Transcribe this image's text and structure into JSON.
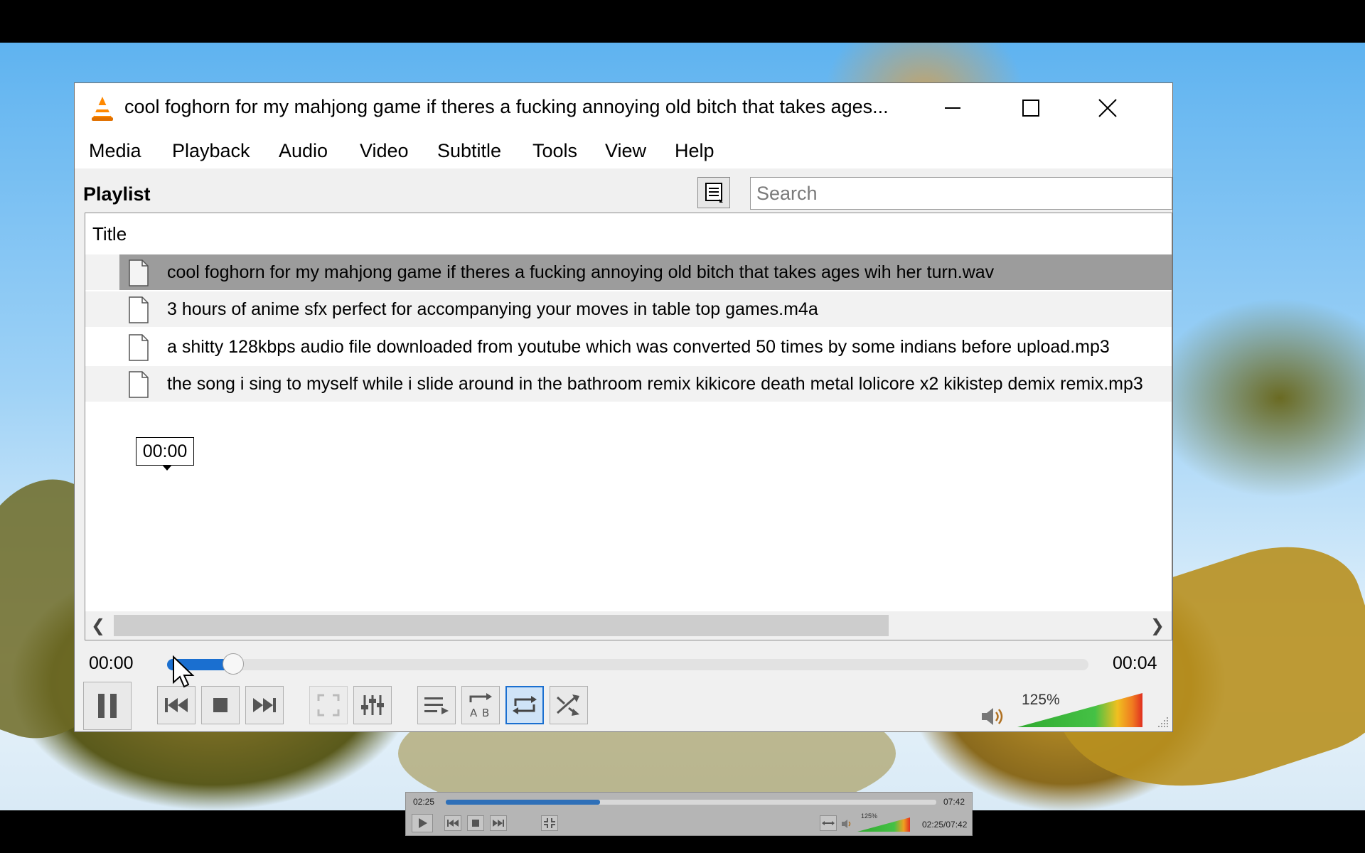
{
  "window": {
    "title": "cool foghorn for my mahjong game if theres a fucking annoying old bitch that takes ages...",
    "controls": [
      "minimize-icon",
      "maximize-icon",
      "close-icon"
    ]
  },
  "menu": [
    "Media",
    "Playback",
    "Audio",
    "Video",
    "Subtitle",
    "Tools",
    "View",
    "Help"
  ],
  "playlist": {
    "label": "Playlist",
    "search_placeholder": "Search",
    "column_title": "Title",
    "items": [
      "cool foghorn for my mahjong game if theres a fucking annoying old bitch that takes ages wih her turn.wav",
      "3 hours of anime sfx perfect for accompanying your moves in table top games.m4a",
      "a shitty 128kbps audio file downloaded from youtube which was converted 50 times by some indians before upload.mp3",
      "the song i sing to myself while i slide around in the bathroom remix kikicore death metal lolicore x2 kikistep demix remix.mp3"
    ],
    "selected_index": 0
  },
  "tooltip": "00:00",
  "seek": {
    "elapsed": "00:00",
    "total": "00:04",
    "progress": 0.06
  },
  "controls": [
    "pause-icon",
    "previous-icon",
    "stop-icon",
    "next-icon",
    "fullscreen-icon",
    "extended-settings-icon",
    "playlist-icon",
    "ab-loop-icon",
    "loop-icon",
    "shuffle-icon"
  ],
  "volume": {
    "label": "125%",
    "level": 1.0
  },
  "fullscreen_controller": {
    "elapsed": "02:25",
    "total": "07:42",
    "progress": 0.315,
    "volume_label": "125%",
    "timecode": "02:25/07:42"
  },
  "colors": {
    "accent": "#1a6fd0",
    "selected_row": "#9c9c9c"
  }
}
